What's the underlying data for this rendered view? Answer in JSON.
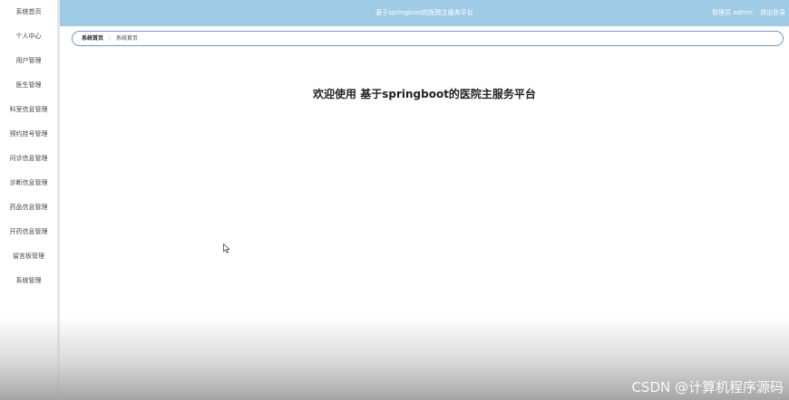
{
  "sidebar": {
    "items": [
      {
        "label": "系统首页"
      },
      {
        "label": "个人中心"
      },
      {
        "label": "用户管理"
      },
      {
        "label": "医生管理"
      },
      {
        "label": "科室信息管理"
      },
      {
        "label": "预约挂号管理"
      },
      {
        "label": "问诊信息管理"
      },
      {
        "label": "诊断信息管理"
      },
      {
        "label": "药品信息管理"
      },
      {
        "label": "开药信息管理"
      },
      {
        "label": "留言板管理"
      },
      {
        "label": "系统管理"
      }
    ]
  },
  "header": {
    "title": "基于springboot的医院主服务平台",
    "user": "管理员 admin",
    "logout": "退出登录",
    "color": "#9fcbe6"
  },
  "breadcrumb": {
    "home": "系统首页",
    "separator": "⋮",
    "current": "系统首页"
  },
  "main": {
    "welcome": "欢迎使用 基于springboot的医院主服务平台"
  },
  "watermark": "CSDN @计算机程序源码"
}
